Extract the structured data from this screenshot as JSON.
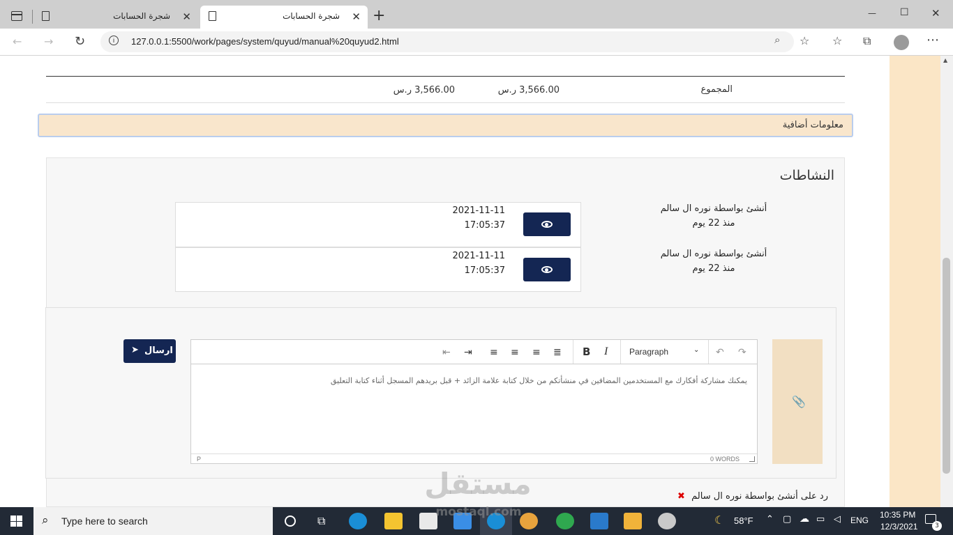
{
  "browser": {
    "tabs": [
      {
        "title": "شجرة الحسابات",
        "close": "✕"
      },
      {
        "title": "شجرة الحسابات",
        "close": "✕"
      }
    ],
    "new_tab": "+",
    "url": "127.0.0.1:5500/work/pages/system/quyud/manual%20quyud2.html",
    "window_controls": {
      "minimize": "—",
      "maximize": "☐",
      "close": "✕"
    }
  },
  "totals": {
    "label": "المجموع",
    "debit": "3,566.00 ر.س",
    "credit": "3,566.00 ر.س"
  },
  "additional_info": "معلومات أضافية",
  "activities": {
    "heading": "النشاطات",
    "items": [
      {
        "by": "أنشئ بواسطة نوره ال سالم",
        "ago": "منذ 22 يوم",
        "date": "2021-11-11",
        "time": "17:05:37"
      },
      {
        "by": "أنشئ بواسطة نوره ال سالم",
        "ago": "منذ 22 يوم",
        "date": "2021-11-11",
        "time": "17:05:37"
      }
    ]
  },
  "editor": {
    "paragraph_select": "Paragraph",
    "bold": "B",
    "italic": "I",
    "placeholder": "يمكنك مشاركة أفكارك مع المستخدمين المضافين في منشأتكم من خلال كتابة علامة الزائد + قبل بريدهم المسجل أثناء كتابة التعليق",
    "status_path": "P",
    "word_count": "0 WORDS",
    "send_label": "ارسال"
  },
  "reply_to": "رد على أنشئ بواسطة نوره ال سالم",
  "watermark": {
    "main": "مستقل",
    "sub": "mostaql.com"
  },
  "taskbar": {
    "search_placeholder": "Type here to search",
    "weather": "58°F",
    "language": "ENG",
    "time": "10:35 PM",
    "date": "12/3/2021",
    "notifications": "3"
  },
  "colors": {
    "accent_dark": "#142653",
    "beige": "#f9e6cc",
    "side_beige": "#fbe6c6"
  }
}
